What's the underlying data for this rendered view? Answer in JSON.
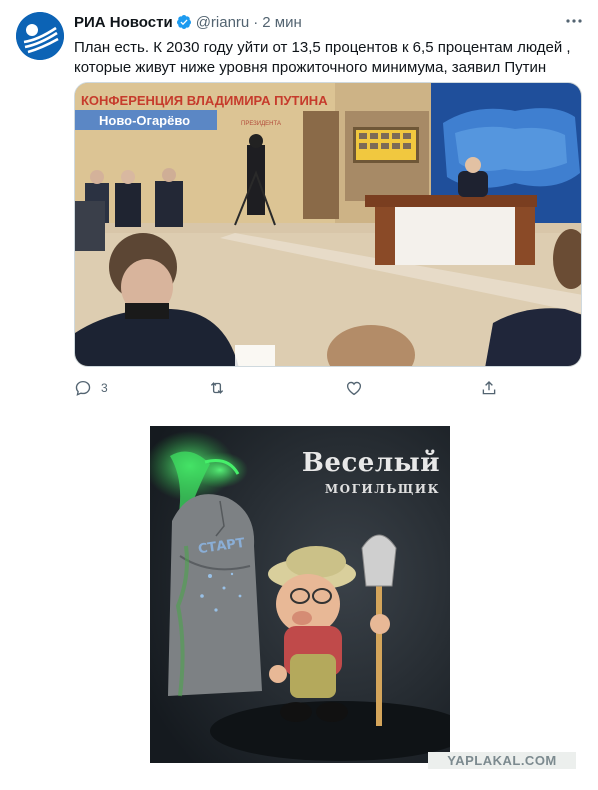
{
  "tweet": {
    "author_name": "РИА Новости",
    "handle": "@rianru",
    "separator": "·",
    "time": "2 мин",
    "text": "План есть. К 2030 году уйти от 13,5 процентов к 6,5 процентам людей , которые живут ниже уровня прожиточного минимума, заявил Путин",
    "verified": true,
    "photo": {
      "banner_title": "КОНФЕРЕНЦИЯ ВЛАДИМИРА ПУТИНА",
      "location_badge": "Ново-Огарёво",
      "sub_label": "ПРЕЗИДЕНТА"
    },
    "actions": {
      "reply_icon": "reply-icon",
      "reply_count": "3",
      "retweet_icon": "retweet-icon",
      "like_icon": "heart-icon",
      "share_icon": "share-icon"
    }
  },
  "meme": {
    "title_line1": "Веселый",
    "title_line2": "МОГИЛЬЩИК",
    "stone_text": "СТАРТ"
  },
  "watermark": "YAPLAKAL.COM",
  "colors": {
    "twitter_blue": "#1d9bf0",
    "muted_text": "#536471",
    "ria_blue": "#0c63b5"
  }
}
